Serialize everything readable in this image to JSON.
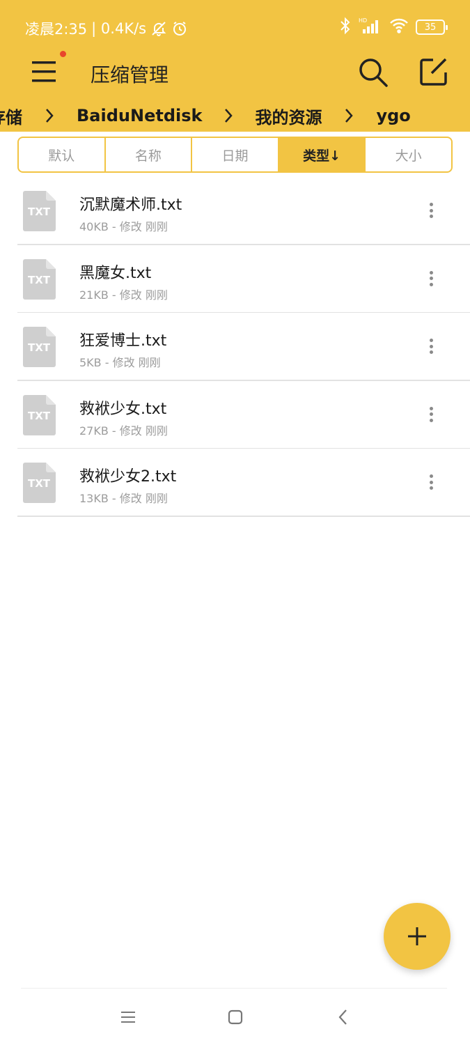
{
  "status_bar": {
    "time_text": "凌晨2:35",
    "network_speed": "| 0.4K/s",
    "battery_level": "35",
    "icons": [
      "mute-bell-icon",
      "alarm-icon",
      "bluetooth-icon",
      "hd-signal-icon",
      "wifi-icon",
      "battery-icon"
    ]
  },
  "app_bar": {
    "title": "压缩管理",
    "has_notification_dot": true
  },
  "breadcrumb": {
    "items": [
      "存储",
      "BaiduNetdisk",
      "我的资源",
      "ygo"
    ]
  },
  "sort_tabs": [
    {
      "label": "默认",
      "active": false
    },
    {
      "label": "名称",
      "active": false
    },
    {
      "label": "日期",
      "active": false
    },
    {
      "label": "类型↓",
      "active": true
    },
    {
      "label": "大小",
      "active": false
    }
  ],
  "files": [
    {
      "name": "沉默魔术师.txt",
      "meta": "40KB - 修改 刚刚",
      "type_label": "TXT"
    },
    {
      "name": "黑魔女.txt",
      "meta": "21KB - 修改 刚刚",
      "type_label": "TXT"
    },
    {
      "name": "狂爱博士.txt",
      "meta": "5KB - 修改 刚刚",
      "type_label": "TXT"
    },
    {
      "name": "救袱少女.txt",
      "meta": "27KB - 修改 刚刚",
      "type_label": "TXT"
    },
    {
      "name": "救袱少女2.txt",
      "meta": "13KB - 修改 刚刚",
      "type_label": "TXT"
    }
  ],
  "colors": {
    "accent": "#F2C443",
    "notification_dot": "#E8452C",
    "file_icon": "#CFCFCF",
    "meta_text": "#9C9C9C"
  }
}
